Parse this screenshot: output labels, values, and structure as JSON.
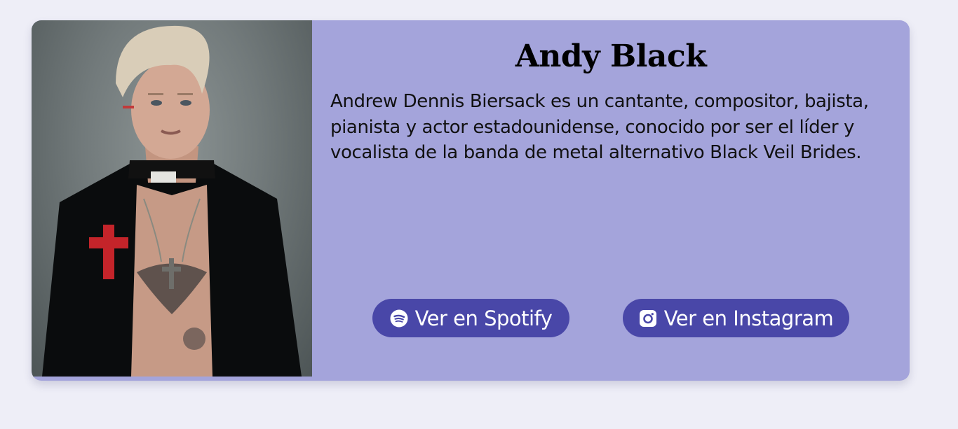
{
  "artist": {
    "name": "Andy Black",
    "bio": "Andrew Dennis Biersack es un cantante, compositor, bajista, pianista y actor estadounidense, conocido por ser el líder y vocalista de la banda de metal alternativo Black Veil Brides."
  },
  "buttons": {
    "spotify_label": "Ver en Spotify",
    "spotify_icon": "spotify-icon",
    "instagram_label": "Ver en Instagram",
    "instagram_icon": "instagram-icon"
  },
  "colors": {
    "page_background": "#eeeef7",
    "card_background": "#a4a4db",
    "button_background": "#4947a8",
    "button_text": "#ffffff"
  }
}
